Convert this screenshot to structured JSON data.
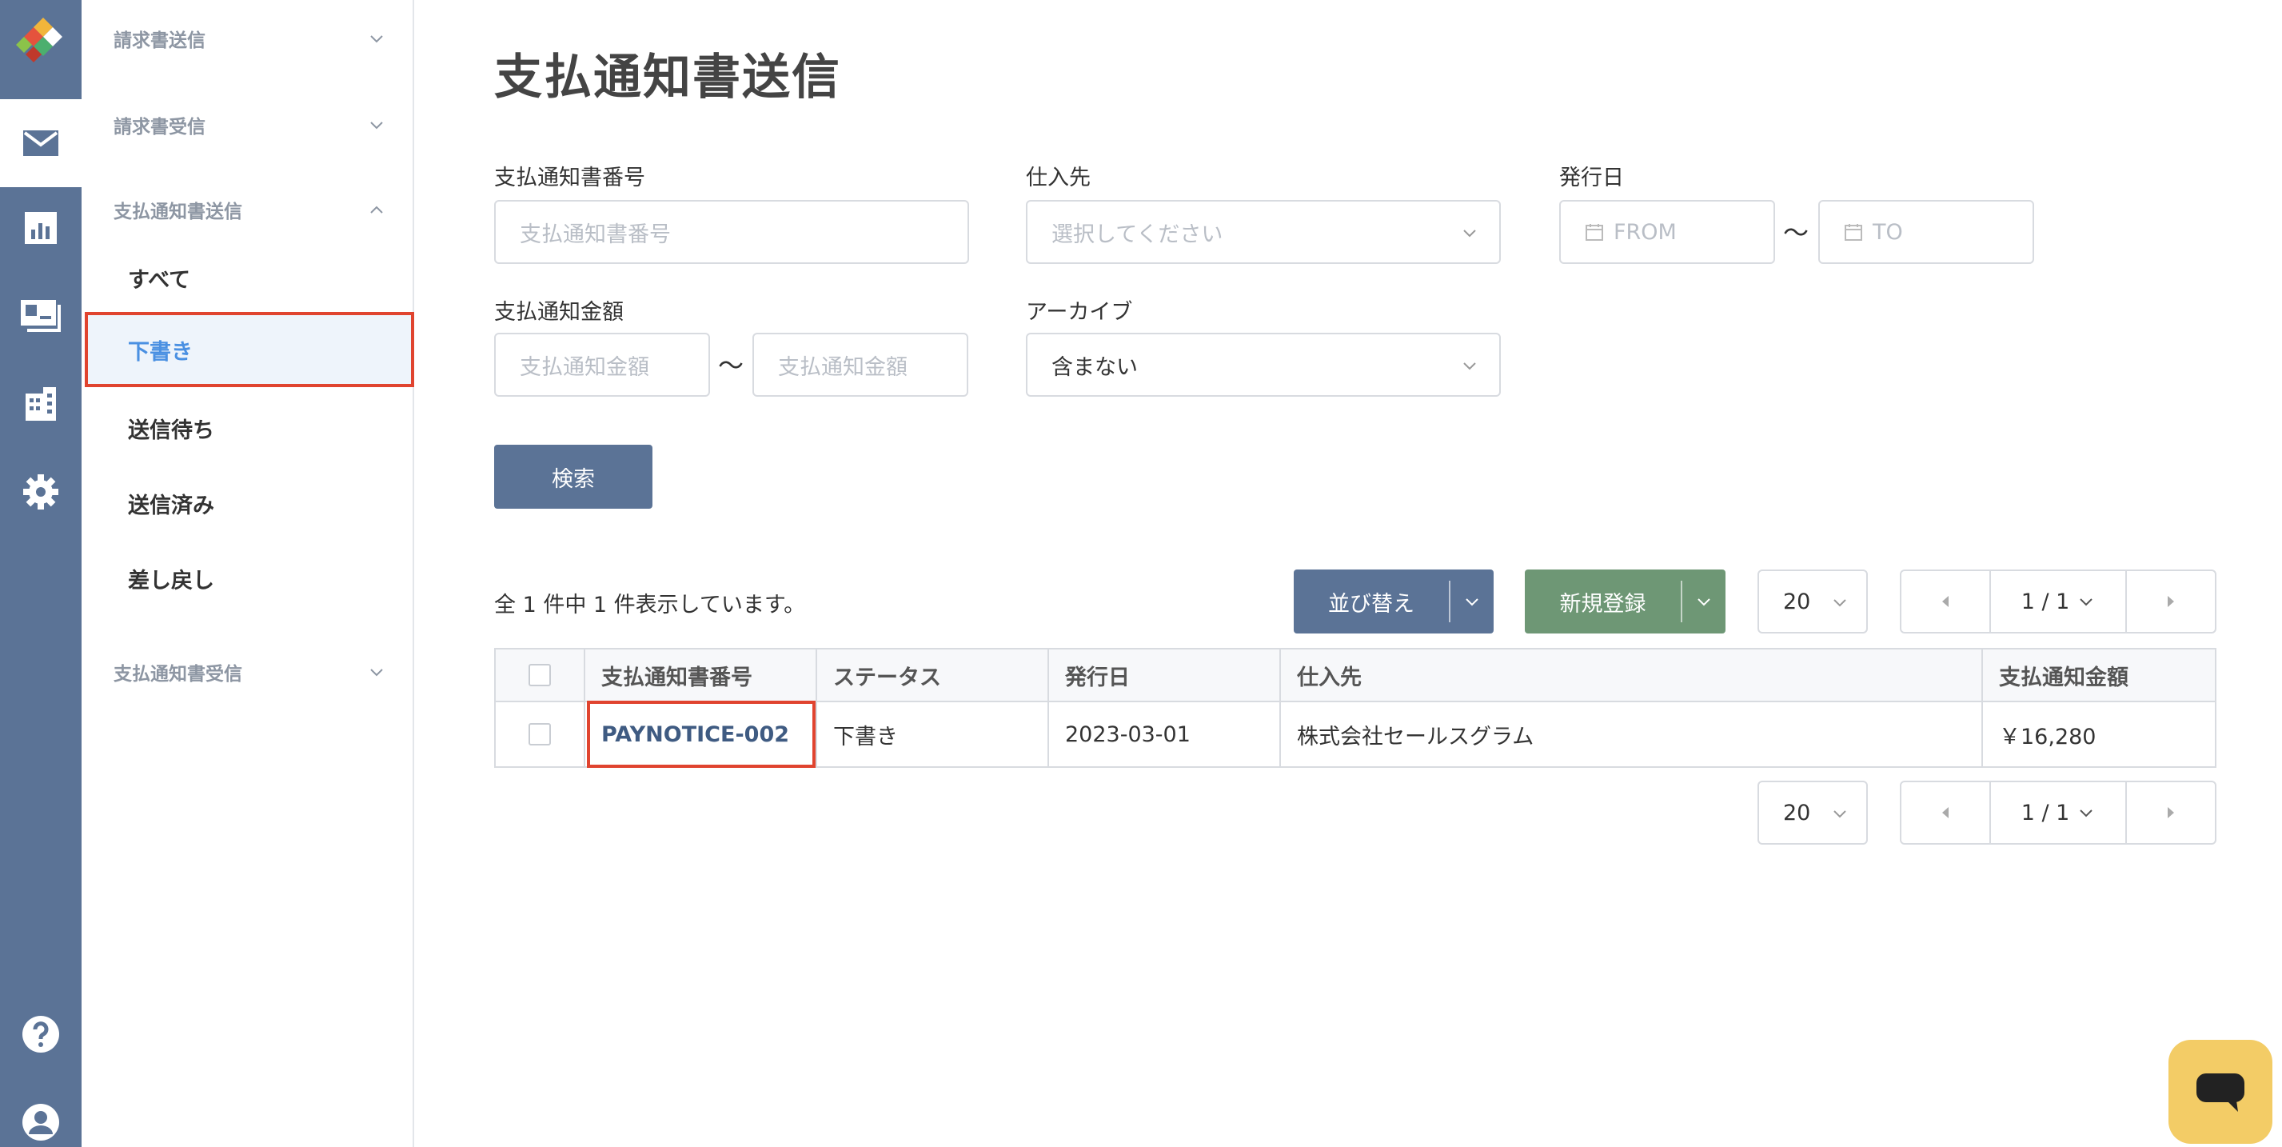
{
  "rail": {
    "items": [
      "logo-icon",
      "mail-icon",
      "chart-icon",
      "payment-icon",
      "building-icon",
      "gear-icon",
      "help-icon",
      "user-icon"
    ],
    "active": "mail-icon",
    "color": "#5b7396"
  },
  "subnav": {
    "groups": [
      {
        "label": "請求書送信"
      },
      {
        "label": "請求書受信"
      },
      {
        "label": "支払通知書送信"
      },
      {
        "label": "支払通知書受信"
      }
    ],
    "items": [
      {
        "label": "すべて"
      },
      {
        "label": "下書き"
      },
      {
        "label": "送信待ち"
      },
      {
        "label": "送信済み"
      },
      {
        "label": "差し戻し"
      }
    ],
    "active_color": "#4a90e2"
  },
  "page": {
    "title": "支払通知書送信"
  },
  "filters": {
    "notice_number_label": "支払通知書番号",
    "notice_number_placeholder": "支払通知書番号",
    "supplier_label": "仕入先",
    "supplier_placeholder": "選択してください",
    "issue_date_label": "発行日",
    "date_from_placeholder": "FROM",
    "date_to_placeholder": "TO",
    "amount_label": "支払通知金額",
    "amount_min_placeholder": "支払通知金額",
    "amount_max_placeholder": "支払通知金額",
    "archive_label": "アーカイブ",
    "archive_value": "含まない",
    "tilde": "〜",
    "search_button": "検索"
  },
  "toolbar": {
    "result_text": "全 1 件中 1 件表示しています。",
    "sort_button": "並び替え",
    "new_button": "新規登録",
    "per_page": "20",
    "page_indicator": "1 / 1"
  },
  "table": {
    "columns": [
      "支払通知書番号",
      "ステータス",
      "発行日",
      "仕入先",
      "支払通知金額"
    ],
    "rows": [
      {
        "number": "PAYNOTICE-002",
        "status": "下書き",
        "issue_date": "2023-03-01",
        "supplier": "株式会社セールスグラム",
        "amount": "￥16,280"
      }
    ]
  },
  "colors": {
    "primary": "#5b7396",
    "success": "#6e9775",
    "highlight": "#e0442f",
    "chat": "#f3cc66"
  }
}
